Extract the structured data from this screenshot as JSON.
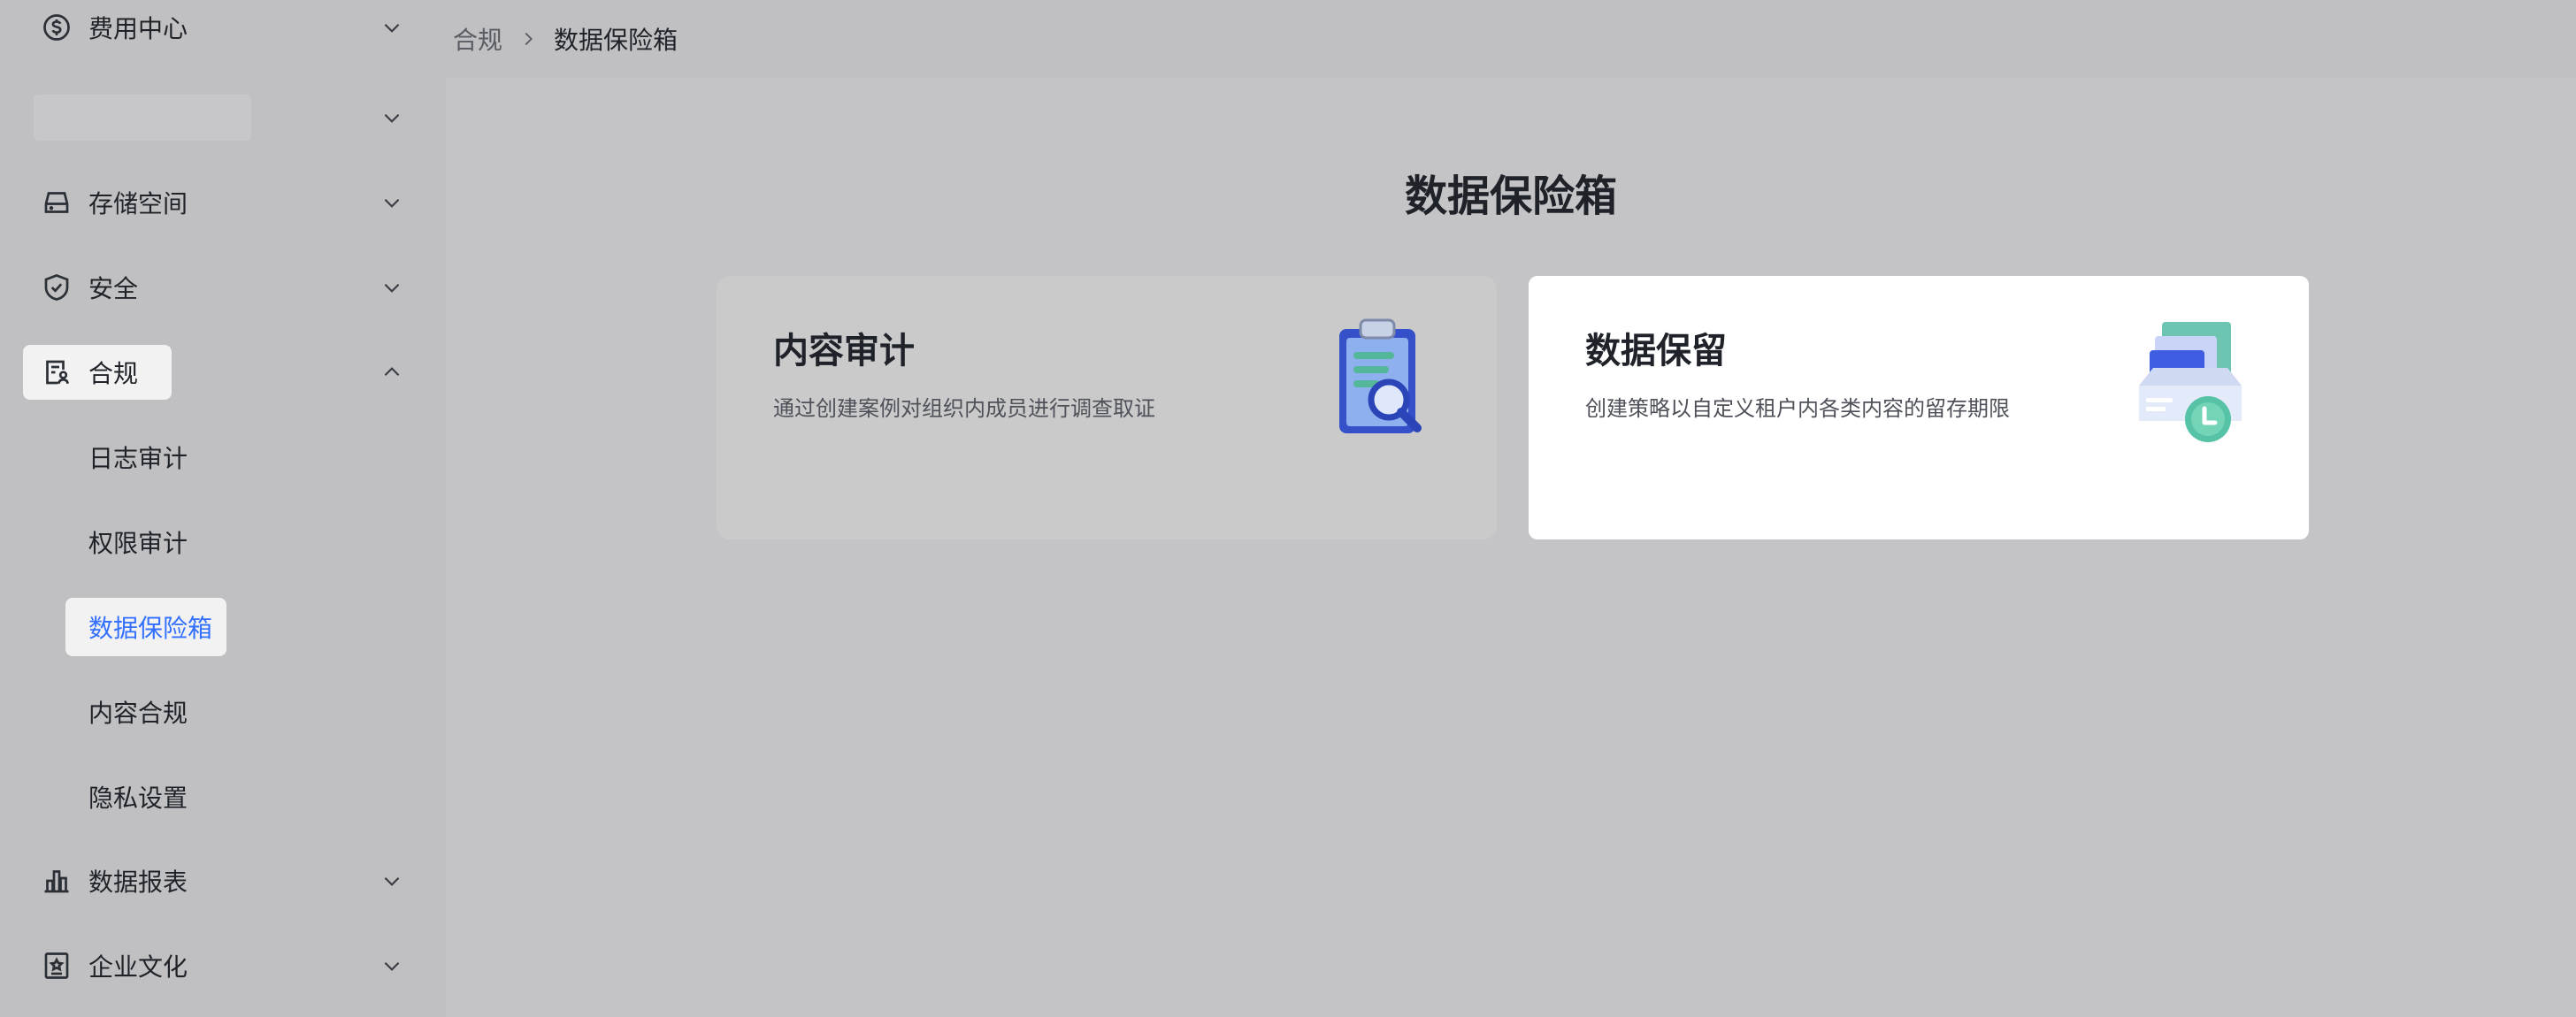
{
  "sidebar": {
    "items": [
      {
        "label": "费用中心",
        "icon": "dollar-circle-icon",
        "expanded": false
      },
      {
        "label": "",
        "icon": "",
        "expanded": false,
        "placeholder": true
      },
      {
        "label": "存储空间",
        "icon": "storage-icon",
        "expanded": false
      },
      {
        "label": "安全",
        "icon": "shield-icon",
        "expanded": false
      },
      {
        "label": "合规",
        "icon": "compliance-doc-icon",
        "expanded": true,
        "children": [
          {
            "label": "日志审计"
          },
          {
            "label": "权限审计"
          },
          {
            "label": "数据保险箱",
            "selected": true
          },
          {
            "label": "内容合规"
          },
          {
            "label": "隐私设置"
          }
        ]
      },
      {
        "label": "数据报表",
        "icon": "bar-chart-icon",
        "expanded": false
      },
      {
        "label": "企业文化",
        "icon": "culture-frame-icon",
        "expanded": false
      }
    ]
  },
  "breadcrumb": {
    "parent": "合规",
    "current": "数据保险箱"
  },
  "main": {
    "title": "数据保险箱",
    "cards": [
      {
        "title": "内容审计",
        "description": "通过创建案例对组织内成员进行调查取证",
        "icon": "clipboard-magnifier-icon"
      },
      {
        "title": "数据保留",
        "description": "创建策略以自定义租户内各类内容的留存期限",
        "icon": "archive-clock-icon"
      }
    ]
  },
  "colors": {
    "accent": "#3370ff",
    "text": "#1f2329",
    "overlay_bg": "#c4c4c6",
    "card_highlight": "#ffffff"
  }
}
